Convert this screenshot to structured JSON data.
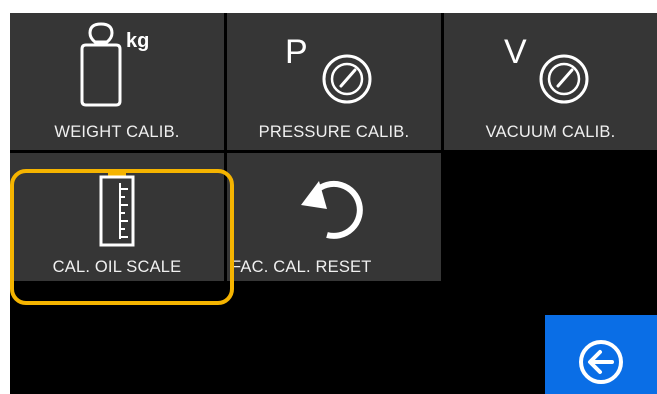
{
  "menu": {
    "tiles": [
      {
        "label": "WEIGHT CALIB.",
        "icon": "weight-kg-icon",
        "unit": "kg"
      },
      {
        "label": "PRESSURE CALIB.",
        "icon": "pressure-gauge-icon",
        "letter": "P"
      },
      {
        "label": "VACUUM CALIB.",
        "icon": "vacuum-gauge-icon",
        "letter": "V"
      },
      {
        "label": "CAL. OIL SCALE",
        "icon": "oil-scale-icon",
        "selected": true
      },
      {
        "label": "FAC. CAL. RESET",
        "icon": "reset-icon"
      }
    ]
  },
  "back": {
    "icon": "back-arrow-icon"
  },
  "colors": {
    "tile_bg": "#363636",
    "screen_bg": "#000000",
    "highlight": "#f5b400",
    "back_bg": "#0a6ee6",
    "oil_cap": "#f5b400"
  }
}
